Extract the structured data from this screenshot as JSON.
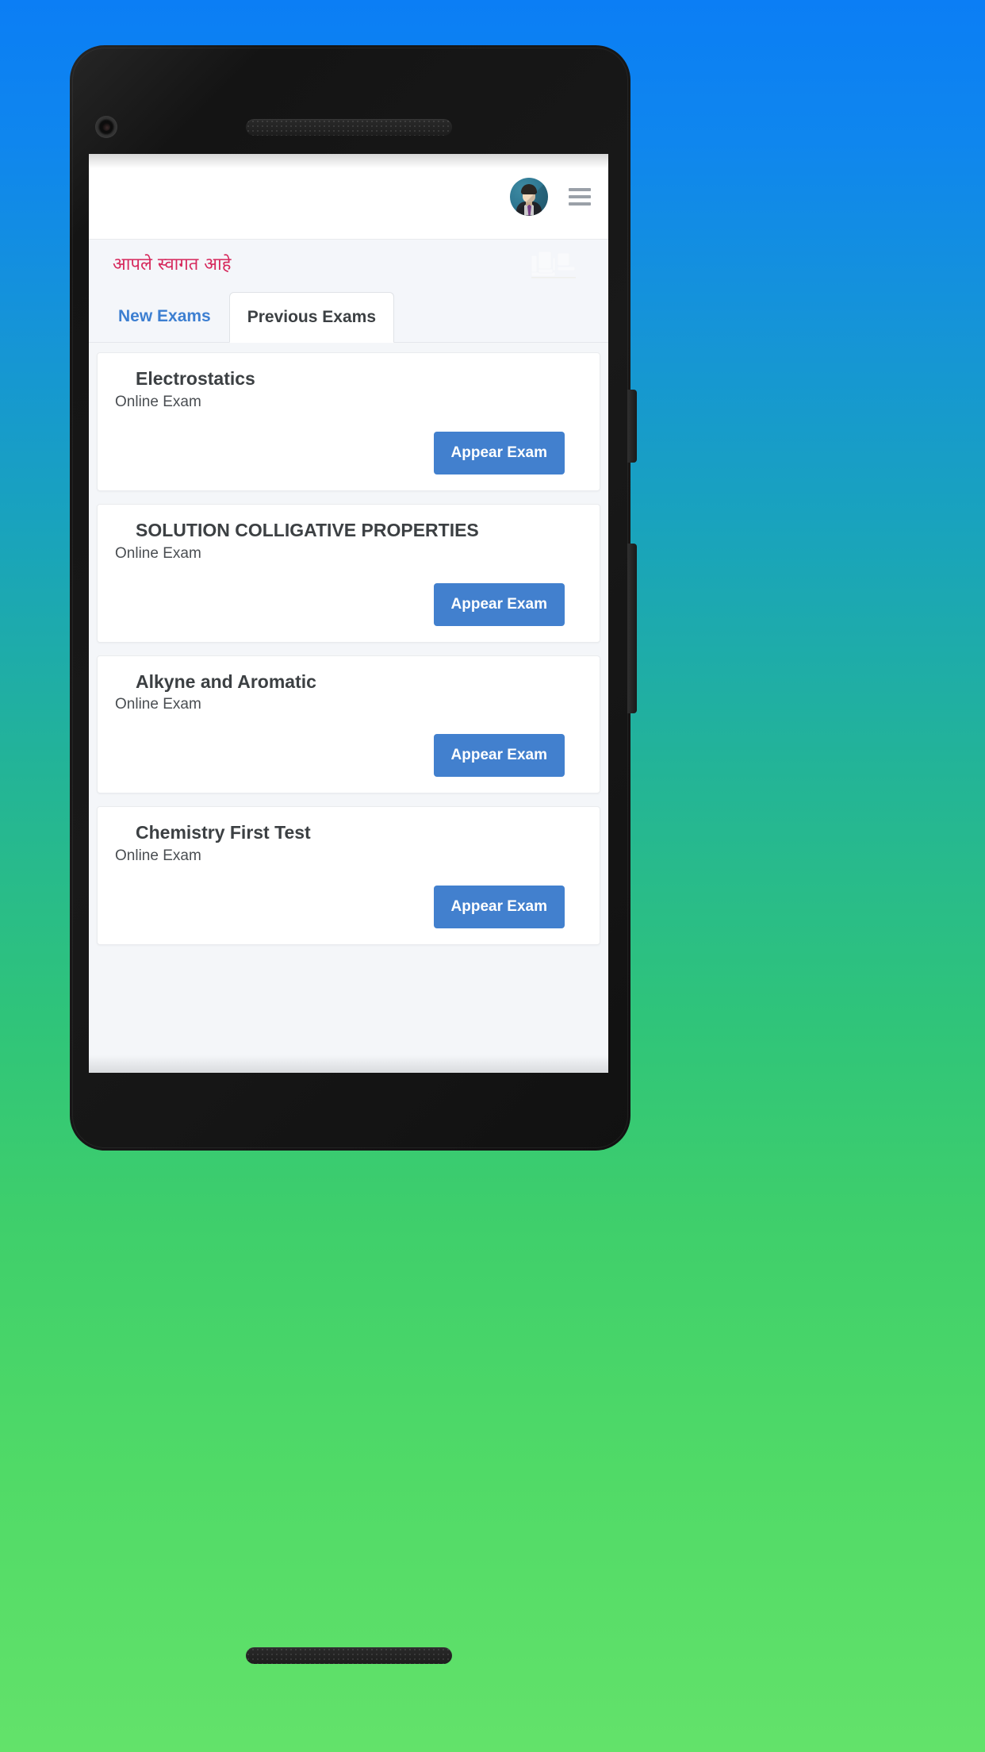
{
  "background": {
    "gradient_top": "#0b7ef5",
    "gradient_bottom": "#63e26a"
  },
  "device": {
    "frame_color": "#181818",
    "camera_icon": "camera-lens-icon",
    "earpiece_icon": "earpiece-speaker-icon",
    "bottom_speaker_icon": "bottom-speaker-icon",
    "power_button": "power-button",
    "volume_button": "volume-rocker-button"
  },
  "header": {
    "avatar_icon": "user-avatar-icon",
    "menu_icon": "hamburger-menu-icon",
    "background": "#ffffff"
  },
  "welcome": {
    "text": "आपले स्वागत आहे",
    "color": "#d6285c",
    "art_icon": "books-study-watermark-icon"
  },
  "tabs": [
    {
      "label": "New Exams",
      "active": false,
      "color": "#3d7fd1"
    },
    {
      "label": "Previous Exams",
      "active": true,
      "color": "#3c4043"
    }
  ],
  "exams": [
    {
      "title": "Electrostatics",
      "subtitle": "Online Exam",
      "button_label": "Appear Exam"
    },
    {
      "title": "SOLUTION COLLIGATIVE PROPERTIES",
      "subtitle": "Online Exam",
      "button_label": "Appear Exam"
    },
    {
      "title": "Alkyne and Aromatic",
      "subtitle": "Online Exam",
      "button_label": "Appear Exam"
    },
    {
      "title": "Chemistry First Test",
      "subtitle": "Online Exam",
      "button_label": "Appear Exam"
    }
  ],
  "colors": {
    "accent_blue": "#4280ce",
    "tab_link_blue": "#3d7fd1",
    "welcome_pink": "#d6285c",
    "page_bg": "#f4f6f9",
    "card_bg": "#ffffff"
  }
}
